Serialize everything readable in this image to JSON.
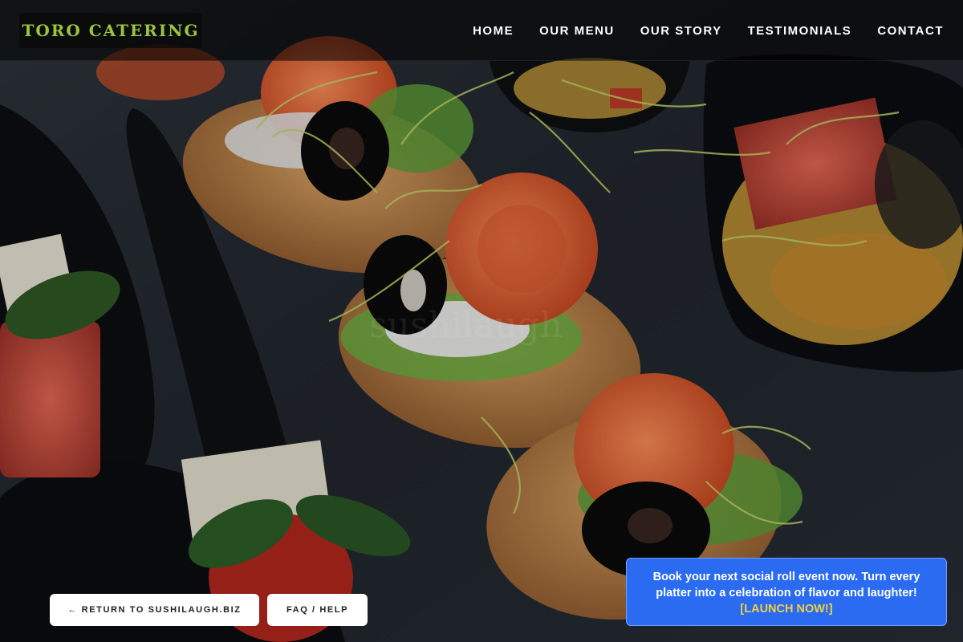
{
  "header": {
    "logo": "TORO CATERING",
    "nav": [
      "HOME",
      "OUR MENU",
      "OUR STORY",
      "TESTIMONIALS",
      "CONTACT"
    ]
  },
  "hero": {
    "image_description_icon": "food-platter-photo",
    "watermark": "sushilaugh"
  },
  "footer_buttons": {
    "return": "← RETURN TO SUSHILAUGH.BIZ",
    "faq": "FAQ / HELP"
  },
  "promo": {
    "text": "Book your next social roll event now. Turn every platter into a celebration of flavor and laughter!",
    "cta": "[LAUNCH NOW!]"
  },
  "colors": {
    "logo": "#9bc53d",
    "promo_bg": "#2a6bf2",
    "promo_cta": "#f2d23a"
  }
}
